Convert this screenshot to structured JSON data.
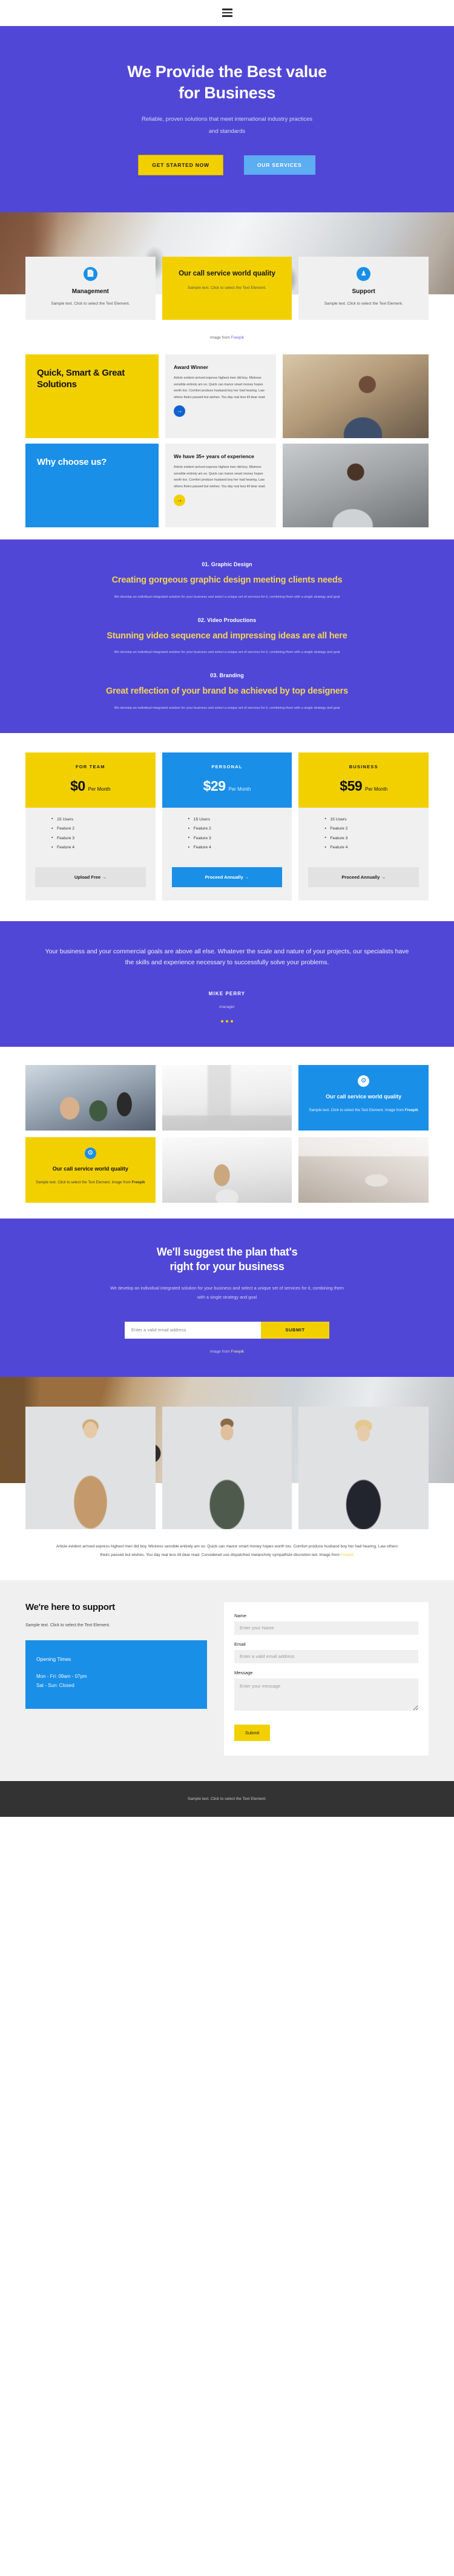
{
  "nav": {
    "menu_icon": "hamburger-menu-icon"
  },
  "hero": {
    "title_line1": "We Provide the Best value",
    "title_line2": "for Business",
    "subtitle": "Reliable, proven solutions that meet international industry practices and standards",
    "primary_button": "GET STARTED NOW",
    "secondary_button": "OUR SERVICES",
    "bg_color": "#5147d6"
  },
  "cards": {
    "items": [
      {
        "icon": "document-icon",
        "title": "Management",
        "text": "Sample text. Click to select the Text Element."
      },
      {
        "icon": "none",
        "title": "Our call service world quality",
        "text": "Sample text. Click to select the Text Element."
      },
      {
        "icon": "person-icon",
        "title": "Support",
        "text": "Sample text. Click to select the Text Element."
      }
    ],
    "credit_prefix": "Image from ",
    "credit_link": "Freepik"
  },
  "features": {
    "rows": [
      {
        "heading": "Quick, Smart & Great Solutions",
        "panel_color": "#f2d000",
        "sub_title": "Award Winner",
        "body": "Article evident arrived express highest men did boy. Mistress sensible entirely am so. Quick can manor smart money hopes worth too. Comfort produce husband boy her had hearing. Law others theirs passed but wishes. You day real less till dear read.",
        "arrow_icon": "arrow-right-icon",
        "arrow_color": "#1263d2"
      },
      {
        "heading": "Why choose us?",
        "panel_color": "#1a8fe8",
        "sub_title": "We have 35+ years of experience",
        "body": "Article evident arrived express highest men did boy. Mistress sensible entirely am so. Quick can manor smart money hopes worth too. Comfort produce husband boy her had hearing. Law others theirs passed but wishes. You day real less till dear read.",
        "arrow_icon": "arrow-right-icon",
        "arrow_color": "#f2d000"
      }
    ]
  },
  "services": {
    "bg_color": "#5147d6",
    "accent_color": "#f2d456",
    "items": [
      {
        "number": "01. Graphic Design",
        "headline": "Creating gorgeous graphic design meeting clients needs",
        "description": "We develop an individual integrated solution for your business and select a unique set of services for it, combining them with a single strategy and goal"
      },
      {
        "number": "02. Video Productions",
        "headline": "Stunning video sequence and impressing ideas are all here",
        "description": "We develop an individual integrated solution for your business and select a unique set of services for it, combining them with a single strategy and goal"
      },
      {
        "number": "03. Branding",
        "headline": "Great reflection of your brand be achieved by top designers",
        "description": "We develop an individual integrated solution for your business and select a unique set of services for it, combining them with a single strategy and goal"
      }
    ]
  },
  "pricing": {
    "plans": [
      {
        "name": "FOR TEAM",
        "price": "$0",
        "period": "Per Month",
        "features": [
          "15 Users",
          "Feature 2",
          "Feature 3",
          "Feature 4"
        ],
        "cta": "Upload Free →",
        "header_color": "#f2d000",
        "cta_color": "#e2e2e2"
      },
      {
        "name": "PERSONAL",
        "price": "$29",
        "period": "Per Month",
        "features": [
          "15 Users",
          "Feature 2",
          "Feature 3",
          "Feature 4"
        ],
        "cta": "Proceed Annually →",
        "header_color": "#1a8fe8",
        "cta_color": "#1a8fe8"
      },
      {
        "name": "BUSINESS",
        "price": "$59",
        "period": "Per Month",
        "features": [
          "15 Users",
          "Feature 2",
          "Feature 3",
          "Feature 4"
        ],
        "cta": "Proceed Annually →",
        "header_color": "#f2d000",
        "cta_color": "#e2e2e2"
      }
    ]
  },
  "testimonial": {
    "quote": "Your business and your commercial goals are above all else. Whatever the scale and nature of your projects, our specialists have the skills and experience necessary to successfully solve your problems.",
    "author": "MIKE PERRY",
    "role": "manager",
    "dots": 3,
    "dot_color": "#f2d000"
  },
  "gallery": {
    "tiles": [
      {
        "kind": "photo",
        "id": "team-meeting-photo"
      },
      {
        "kind": "photo",
        "id": "office-desk-photo"
      },
      {
        "kind": "cta",
        "color": "#1a8fe8",
        "icon": "gear-icon",
        "title": "Our call service world quality",
        "text": "Sample text. Click to select the Text Element. Image from ",
        "link": "Freepik"
      },
      {
        "kind": "cta",
        "color": "#f2d000",
        "icon": "gear-icon",
        "title": "Our call service world quality",
        "text": "Sample text. Click to select the Text Element. Image from ",
        "link": "Freepik"
      },
      {
        "kind": "photo",
        "id": "woman-at-laptop-photo"
      },
      {
        "kind": "photo",
        "id": "office-lobby-photo"
      }
    ]
  },
  "newsletter": {
    "title_line1": "We'll suggest the plan that's",
    "title_line2": "right for your business",
    "subtitle": "We develop an individual integrated solution for your business and select a unique set of services for it, combining them with a single strategy and goal",
    "input_placeholder": "Enter a valid email address",
    "input_value": "",
    "submit_label": "SUBMIT",
    "credit_prefix": "Image from ",
    "credit_link": "Freepik"
  },
  "team": {
    "members": [
      {
        "id": "team-member-1"
      },
      {
        "id": "team-member-2"
      },
      {
        "id": "team-member-3"
      }
    ],
    "copy": "Article evident arrived express highest men did boy. Mistress sensible entirely am so. Quick can manor smart money hopes worth too. Comfort produce husband boy her had hearing. Law others theirs passed but wishes. You day real less till dear read. Considered use dispatched melancholy sympathize discretion led. Image from ",
    "copy_link": "Freepik"
  },
  "contact": {
    "title": "We're here to support",
    "lead": "Sample text. Click to select the Text Element.",
    "hours_title": "Opening Times",
    "hours_weekday": "Mon - Fri: 09am - 07pm",
    "hours_weekend": "Sat - Sun: Closed",
    "fields": {
      "name_label": "Name",
      "name_placeholder": "Enter your Name",
      "name_value": "",
      "email_label": "Email",
      "email_placeholder": "Enter a valid email address",
      "email_value": "",
      "message_label": "Message",
      "message_placeholder": "Enter your message",
      "message_value": ""
    },
    "submit_label": "Submit"
  },
  "footer": {
    "text": "Sample text. Click to select the Text Element.",
    "bg_color": "#333333"
  }
}
